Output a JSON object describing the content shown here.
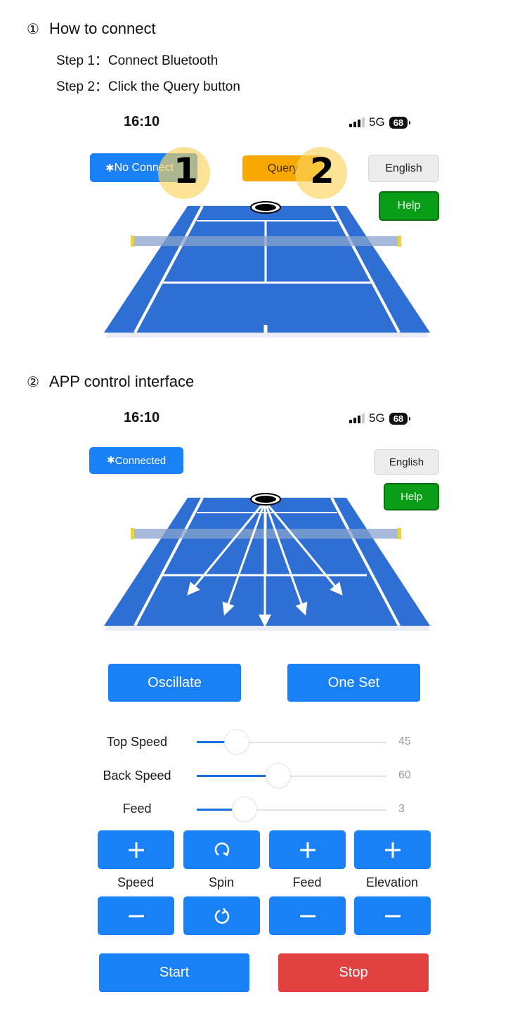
{
  "section1": {
    "number": "①",
    "title": "How to connect",
    "steps": [
      "Step 1：Connect Bluetooth",
      "Step 2：Click the Query button"
    ]
  },
  "section2": {
    "number": "②",
    "title": "APP control interface"
  },
  "screen1": {
    "status": {
      "time": "16:10",
      "network": "5G",
      "battery": "68"
    },
    "connect_label": "No Connect",
    "query_label": "Query",
    "language_label": "English",
    "help_label": "Help",
    "markers": [
      "1",
      "2"
    ]
  },
  "screen2": {
    "status": {
      "time": "16:10",
      "network": "5G",
      "battery": "68"
    },
    "connect_label": "Connected",
    "language_label": "English",
    "help_label": "Help",
    "mode_buttons": [
      "Oscillate",
      "One Set"
    ],
    "sliders": [
      {
        "label": "Top Speed",
        "value": "45",
        "fraction": 0.21
      },
      {
        "label": "Back Speed",
        "value": "60",
        "fraction": 0.43
      },
      {
        "label": "Feed",
        "value": "3",
        "fraction": 0.25
      }
    ],
    "controls": [
      {
        "label": "Speed",
        "up_icon": "plus-icon",
        "down_icon": "minus-icon"
      },
      {
        "label": "Spin",
        "up_icon": "rotate-clockwise-icon",
        "down_icon": "rotate-counterclockwise-icon"
      },
      {
        "label": "Feed",
        "up_icon": "plus-icon",
        "down_icon": "minus-icon"
      },
      {
        "label": "Elevation",
        "up_icon": "plus-icon",
        "down_icon": "minus-icon"
      }
    ],
    "start_label": "Start",
    "stop_label": "Stop"
  },
  "colors": {
    "primary": "#1a80f5",
    "query": "#f8a900",
    "help": "#0a9d17",
    "stop": "#e14141",
    "court": "#2f6fd3"
  }
}
